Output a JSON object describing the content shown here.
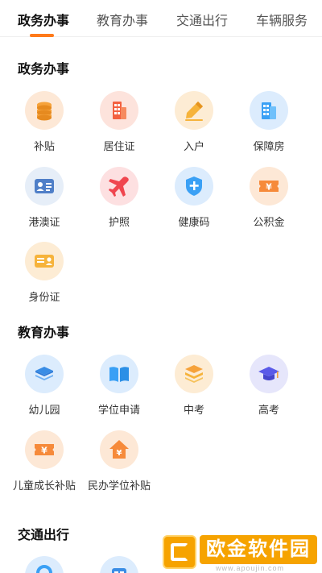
{
  "tabs": [
    {
      "label": "政务办事",
      "active": true
    },
    {
      "label": "教育办事",
      "active": false
    },
    {
      "label": "交通出行",
      "active": false
    },
    {
      "label": "车辆服务",
      "active": false
    }
  ],
  "sections": {
    "gov": {
      "title": "政务办事",
      "items": [
        {
          "label": "补贴",
          "icon": "coins-icon"
        },
        {
          "label": "居住证",
          "icon": "building-icon"
        },
        {
          "label": "入户",
          "icon": "pencil-icon"
        },
        {
          "label": "保障房",
          "icon": "housing-icon"
        },
        {
          "label": "港澳证",
          "icon": "id-card-icon"
        },
        {
          "label": "护照",
          "icon": "airplane-icon"
        },
        {
          "label": "健康码",
          "icon": "shield-plus-icon"
        },
        {
          "label": "公积金",
          "icon": "yuan-ticket-icon"
        },
        {
          "label": "身份证",
          "icon": "identity-card-icon"
        }
      ]
    },
    "edu": {
      "title": "教育办事",
      "items": [
        {
          "label": "幼儿园",
          "icon": "layers-icon"
        },
        {
          "label": "学位申请",
          "icon": "book-icon"
        },
        {
          "label": "中考",
          "icon": "stack-icon"
        },
        {
          "label": "高考",
          "icon": "graduation-cap-icon"
        },
        {
          "label": "儿童成长补贴",
          "icon": "yuan-ticket-icon"
        },
        {
          "label": "民办学位补贴",
          "icon": "yuan-house-icon"
        }
      ]
    },
    "traffic": {
      "title": "交通出行"
    }
  },
  "watermark": {
    "text": "欧金软件园",
    "url": "www.apoujin.com"
  },
  "colors": {
    "accent": "#ff7a1a",
    "coins": "#f6a23a",
    "building": "#f3603f",
    "pencil": "#f6b33b",
    "blue": "#3aa0f5",
    "red": "#f0464f",
    "purple": "#5a5ae8"
  }
}
